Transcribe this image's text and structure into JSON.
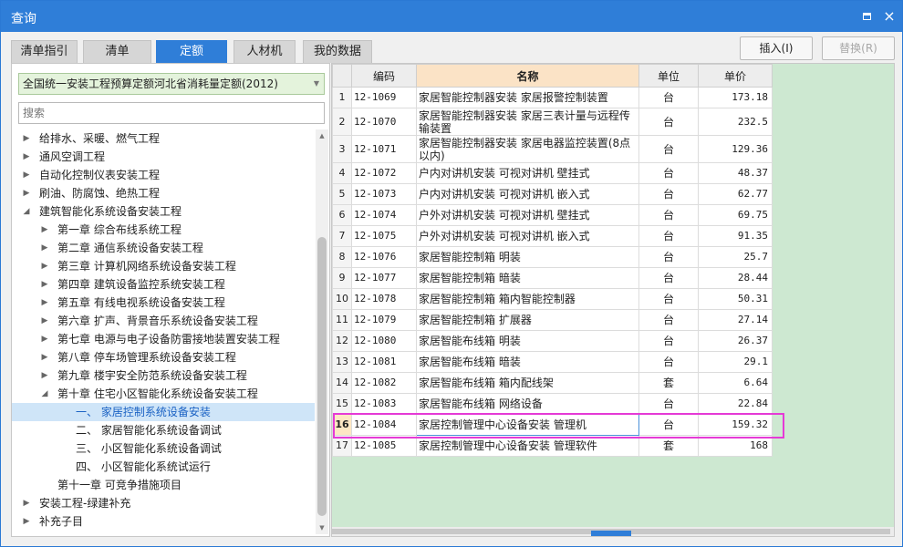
{
  "window": {
    "title": "查询",
    "restore_label": "restore",
    "close_label": "×"
  },
  "tabs": [
    {
      "label": "清单指引"
    },
    {
      "label": "清单"
    },
    {
      "label": "定额"
    },
    {
      "label": "人材机"
    },
    {
      "label": "我的数据"
    }
  ],
  "active_tab": "定额",
  "buttons": {
    "insert": "插入(I)",
    "replace": "替换(R)"
  },
  "library": {
    "selected": "全国统一安装工程预算定额河北省消耗量定额(2012)"
  },
  "search": {
    "placeholder": "搜索"
  },
  "tree": [
    {
      "label": "给排水、采暖、燃气工程",
      "level": 0,
      "state": "collapsed"
    },
    {
      "label": "通风空调工程",
      "level": 0,
      "state": "collapsed"
    },
    {
      "label": "自动化控制仪表安装工程",
      "level": 0,
      "state": "collapsed"
    },
    {
      "label": "刷油、防腐蚀、绝热工程",
      "level": 0,
      "state": "collapsed"
    },
    {
      "label": "建筑智能化系统设备安装工程",
      "level": 0,
      "state": "expanded"
    },
    {
      "label": "第一章 综合布线系统工程",
      "level": 1,
      "state": "collapsed"
    },
    {
      "label": "第二章 通信系统设备安装工程",
      "level": 1,
      "state": "collapsed"
    },
    {
      "label": "第三章 计算机网络系统设备安装工程",
      "level": 1,
      "state": "collapsed"
    },
    {
      "label": "第四章 建筑设备监控系统安装工程",
      "level": 1,
      "state": "collapsed"
    },
    {
      "label": "第五章 有线电视系统设备安装工程",
      "level": 1,
      "state": "collapsed"
    },
    {
      "label": "第六章 扩声、背景音乐系统设备安装工程",
      "level": 1,
      "state": "collapsed"
    },
    {
      "label": "第七章 电源与电子设备防雷接地装置安装工程",
      "level": 1,
      "state": "collapsed"
    },
    {
      "label": "第八章 停车场管理系统设备安装工程",
      "level": 1,
      "state": "collapsed"
    },
    {
      "label": "第九章 楼宇安全防范系统设备安装工程",
      "level": 1,
      "state": "collapsed"
    },
    {
      "label": "第十章 住宅小区智能化系统设备安装工程",
      "level": 1,
      "state": "expanded"
    },
    {
      "label": "一、 家居控制系统设备安装",
      "level": 2,
      "state": "leaf",
      "selected": true
    },
    {
      "label": "二、 家居智能化系统设备调试",
      "level": 2,
      "state": "leaf"
    },
    {
      "label": "三、 小区智能化系统设备调试",
      "level": 2,
      "state": "leaf"
    },
    {
      "label": "四、 小区智能化系统试运行",
      "level": 2,
      "state": "leaf"
    },
    {
      "label": "第十一章 可竞争措施项目",
      "level": 1,
      "state": "leaf"
    },
    {
      "label": "安装工程-绿建补充",
      "level": 0,
      "state": "collapsed"
    },
    {
      "label": "补充子目",
      "level": 0,
      "state": "collapsed"
    }
  ],
  "grid": {
    "headers": {
      "idx": "",
      "code": "编码",
      "name": "名称",
      "unit": "单位",
      "price": "单价"
    },
    "rows": [
      {
        "idx": "1",
        "code": "12-1069",
        "name": "家居智能控制器安装 家居报警控制装置",
        "unit": "台",
        "price": "173.18"
      },
      {
        "idx": "2",
        "code": "12-1070",
        "name": "家居智能控制器安装 家居三表计量与远程传输装置",
        "unit": "台",
        "price": "232.5"
      },
      {
        "idx": "3",
        "code": "12-1071",
        "name": "家居智能控制器安装 家居电器监控装置(8点以内)",
        "unit": "台",
        "price": "129.36"
      },
      {
        "idx": "4",
        "code": "12-1072",
        "name": "户内对讲机安装 可视对讲机 壁挂式",
        "unit": "台",
        "price": "48.37"
      },
      {
        "idx": "5",
        "code": "12-1073",
        "name": "户内对讲机安装 可视对讲机 嵌入式",
        "unit": "台",
        "price": "62.77"
      },
      {
        "idx": "6",
        "code": "12-1074",
        "name": "户外对讲机安装 可视对讲机 壁挂式",
        "unit": "台",
        "price": "69.75"
      },
      {
        "idx": "7",
        "code": "12-1075",
        "name": "户外对讲机安装 可视对讲机 嵌入式",
        "unit": "台",
        "price": "91.35"
      },
      {
        "idx": "8",
        "code": "12-1076",
        "name": "家居智能控制箱 明装",
        "unit": "台",
        "price": "25.7"
      },
      {
        "idx": "9",
        "code": "12-1077",
        "name": "家居智能控制箱 暗装",
        "unit": "台",
        "price": "28.44"
      },
      {
        "idx": "10",
        "code": "12-1078",
        "name": "家居智能控制箱 箱内智能控制器",
        "unit": "台",
        "price": "50.31"
      },
      {
        "idx": "11",
        "code": "12-1079",
        "name": "家居智能控制箱 扩展器",
        "unit": "台",
        "price": "27.14"
      },
      {
        "idx": "12",
        "code": "12-1080",
        "name": "家居智能布线箱 明装",
        "unit": "台",
        "price": "26.37"
      },
      {
        "idx": "13",
        "code": "12-1081",
        "name": "家居智能布线箱 暗装",
        "unit": "台",
        "price": "29.1"
      },
      {
        "idx": "14",
        "code": "12-1082",
        "name": "家居智能布线箱 箱内配线架",
        "unit": "套",
        "price": "6.64"
      },
      {
        "idx": "15",
        "code": "12-1083",
        "name": "家居智能布线箱 网络设备",
        "unit": "台",
        "price": "22.84"
      },
      {
        "idx": "16",
        "code": "12-1084",
        "name": "家居控制管理中心设备安装 管理机",
        "unit": "台",
        "price": "159.32",
        "highlight": true
      },
      {
        "idx": "17",
        "code": "12-1085",
        "name": "家居控制管理中心设备安装 管理软件",
        "unit": "套",
        "price": "168"
      }
    ]
  },
  "colors": {
    "titlebar": "#2f7ed8",
    "active_tab": "#2f7ed8",
    "highlight_outline": "#e53ad6",
    "grid_background": "#cde8d1"
  }
}
